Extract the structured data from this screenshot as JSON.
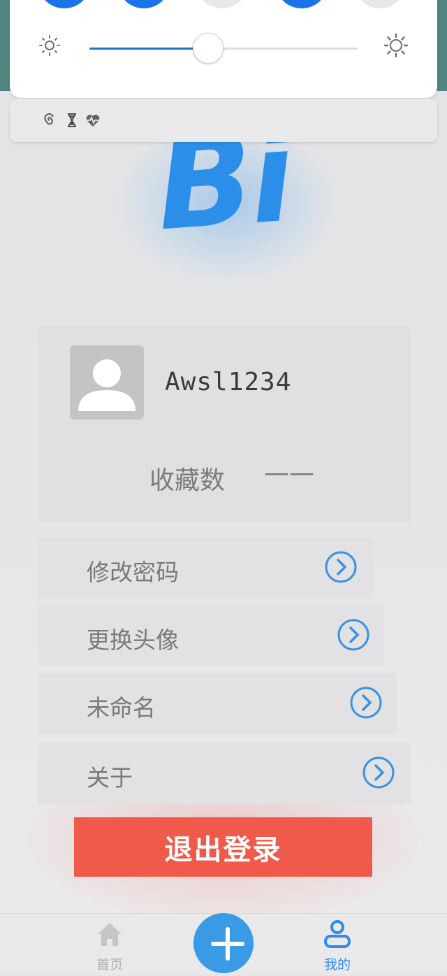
{
  "quick_settings": {
    "tiles": [
      {
        "state": "on",
        "color": "#1a73e8"
      },
      {
        "state": "on",
        "color": "#1a73e8"
      },
      {
        "state": "off",
        "color": "#e8e8ea"
      },
      {
        "state": "on",
        "color": "#1a73e8"
      },
      {
        "state": "off",
        "color": "#e8e8ea"
      }
    ],
    "brightness_icon_low": "sun-low-icon",
    "brightness_icon_high": "sun-high-icon",
    "brightness_level": 0.44
  },
  "notification": {
    "icons": [
      "spiral-icon",
      "hourglass-icon",
      "heartbeat-icon"
    ]
  },
  "logo": {
    "text": "Bi",
    "color": "#2b8fea"
  },
  "profile": {
    "username": "Awsl1234",
    "favorites_label": "收藏数",
    "favorites_value": "——"
  },
  "menu": {
    "items": [
      {
        "label": "修改密码"
      },
      {
        "label": "更换头像"
      },
      {
        "label": "未命名"
      },
      {
        "label": "关于"
      }
    ]
  },
  "logout_label": "退出登录",
  "tabbar": {
    "home_label": "首页",
    "add_icon": "plus-icon",
    "mine_label": "我的",
    "active_color": "#2f8de4",
    "inactive_color": "#b0b0b3"
  },
  "colors": {
    "accent": "#2b8fea",
    "logout": "#ef5a4a"
  }
}
